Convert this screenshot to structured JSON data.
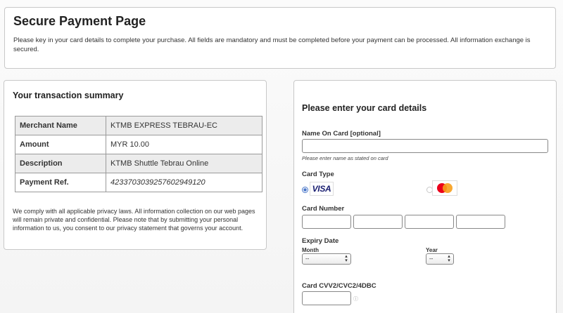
{
  "header": {
    "title": "Secure Payment Page",
    "description": "Please key in your card details to complete your purchase. All fields are mandatory and must be completed before your payment can be processed. All information exchange is secured."
  },
  "summary": {
    "title": "Your transaction summary",
    "rows": [
      {
        "label": "Merchant Name",
        "value": "KTMB EXPRESS TEBRAU-EC"
      },
      {
        "label": "Amount",
        "value": "MYR 10.00"
      },
      {
        "label": "Description",
        "value": "KTMB Shuttle Tebrau Online"
      },
      {
        "label": "Payment Ref.",
        "value": "423370303925760294912​0"
      }
    ],
    "privacy": "We comply with all applicable privacy laws. All information collection on our web pages will remain private and confidential. Please note that by submitting your personal information to us, you consent to our privacy statement that governs your account."
  },
  "card_form": {
    "title": "Please enter your card details",
    "name_label": "Name On Card [optional]",
    "name_value": "",
    "name_hint": "Please enter name as stated on card",
    "card_type_label": "Card Type",
    "card_types": [
      {
        "name": "VISA",
        "selected": true
      },
      {
        "name": "Mastercard",
        "selected": false
      }
    ],
    "visa_text": "VISA",
    "card_number_label": "Card Number",
    "expiry_label": "Expiry Date",
    "month_label": "Month",
    "month_value": "--",
    "year_label": "Year",
    "year_value": "--",
    "cvv_label": "Card CVV2/CVC2/4DBC",
    "cvv_help": "ⓘ"
  },
  "colors": {
    "visa_blue": "#1a1f71",
    "mc_red": "#eb001b",
    "mc_orange": "#f79e1b",
    "radio_selected": "#4a77c9"
  }
}
